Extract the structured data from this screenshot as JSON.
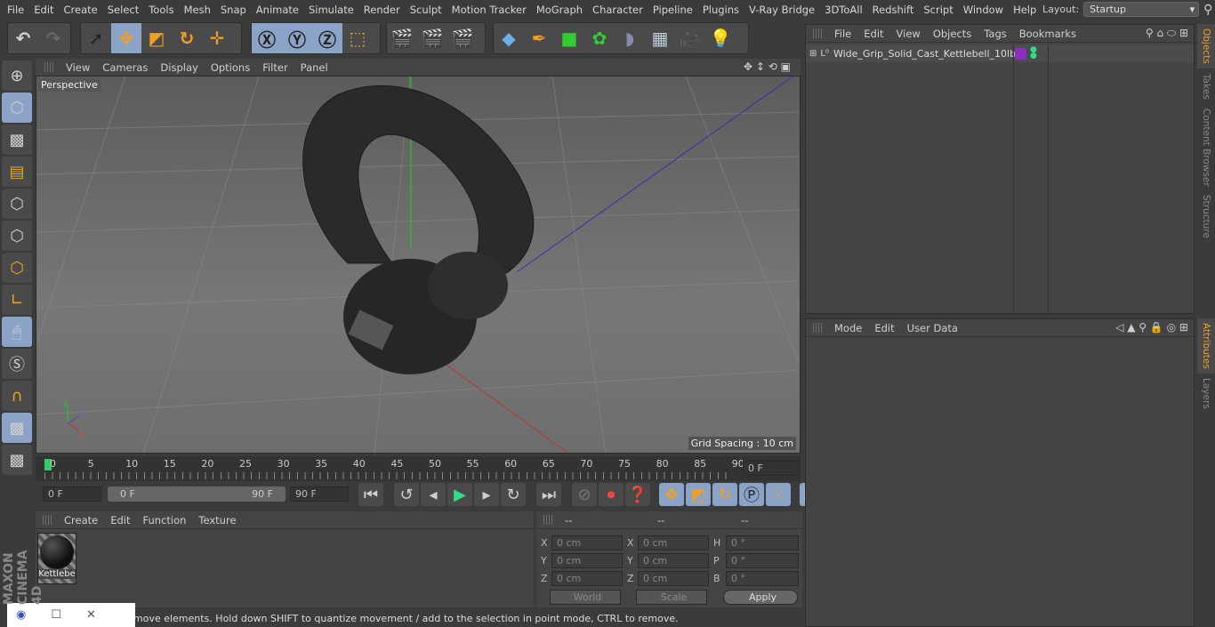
{
  "menu": [
    "File",
    "Edit",
    "Create",
    "Select",
    "Tools",
    "Mesh",
    "Snap",
    "Animate",
    "Simulate",
    "Render",
    "Sculpt",
    "Motion Tracker",
    "MoGraph",
    "Character",
    "Pipeline",
    "Plugins",
    "V-Ray Bridge",
    "3DToAll",
    "Redshift",
    "Script",
    "Window",
    "Help"
  ],
  "layout": {
    "label": "Layout:",
    "value": "Startup"
  },
  "viewport": {
    "menu": [
      "View",
      "Cameras",
      "Display",
      "Options",
      "Filter",
      "Panel"
    ],
    "camera": "Perspective",
    "grid_spacing": "Grid Spacing : 10 cm"
  },
  "objects": {
    "menu": [
      "File",
      "Edit",
      "View",
      "Objects",
      "Tags",
      "Bookmarks"
    ],
    "items": [
      {
        "name": "Wide_Grip_Solid_Cast_Kettlebell_10lb",
        "tag_color": "#8a2fc0"
      }
    ]
  },
  "attributes": {
    "menu": [
      "Mode",
      "Edit",
      "User Data"
    ]
  },
  "right_tabs": [
    "Objects",
    "Takes",
    "Content Browser",
    "Structure",
    "Attributes",
    "Layers"
  ],
  "timeline": {
    "ticks": [
      "0",
      "5",
      "10",
      "15",
      "20",
      "25",
      "30",
      "35",
      "40",
      "45",
      "50",
      "55",
      "60",
      "65",
      "70",
      "75",
      "80",
      "85",
      "90"
    ],
    "current": "0 F",
    "start": "0 F",
    "range_start": "0 F",
    "range_end": "90 F",
    "end": "90 F"
  },
  "materials": {
    "menu": [
      "Create",
      "Edit",
      "Function",
      "Texture"
    ],
    "items": [
      {
        "name": "Kettlebe"
      }
    ]
  },
  "coords": {
    "headers": [
      "--",
      "--",
      "--"
    ],
    "rows": [
      {
        "a": "X",
        "av": "0 cm",
        "b": "X",
        "bv": "0 cm",
        "c": "H",
        "cv": "0 °"
      },
      {
        "a": "Y",
        "av": "0 cm",
        "b": "Y",
        "bv": "0 cm",
        "c": "P",
        "cv": "0 °"
      },
      {
        "a": "Z",
        "av": "0 cm",
        "b": "Z",
        "bv": "0 cm",
        "c": "B",
        "cv": "0 °"
      }
    ],
    "space": "World",
    "mode": "Scale",
    "apply": "Apply"
  },
  "status": "move elements. Hold down SHIFT to quantize movement / add to the selection in point mode, CTRL to remove.",
  "brand": "MAXON CINEMA 4D"
}
